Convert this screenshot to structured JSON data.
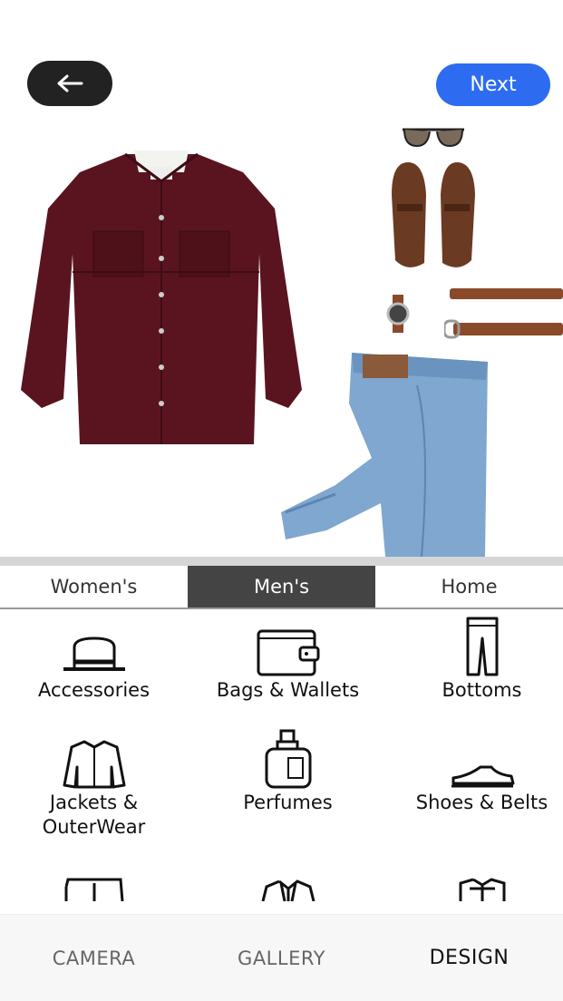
{
  "header": {
    "next_label": "Next"
  },
  "tabs": [
    {
      "label": "Women's",
      "active": false
    },
    {
      "label": "Men's",
      "active": true
    },
    {
      "label": "Home",
      "active": false
    }
  ],
  "categories": [
    {
      "label": "Accessories",
      "icon": "hat-icon"
    },
    {
      "label": "Bags & Wallets",
      "icon": "wallet-icon"
    },
    {
      "label": "Bottoms",
      "icon": "pants-icon"
    },
    {
      "label": "Jackets & OuterWear",
      "icon": "jacket-icon"
    },
    {
      "label": "Perfumes",
      "icon": "perfume-icon"
    },
    {
      "label": "Shoes & Belts",
      "icon": "shoe-icon"
    },
    {
      "label": "",
      "icon": "shorts-icon"
    },
    {
      "label": "",
      "icon": "suit-icon"
    },
    {
      "label": "",
      "icon": "shirt-icon"
    }
  ],
  "bottom_nav": [
    {
      "label": "CAMERA",
      "active": false
    },
    {
      "label": "GALLERY",
      "active": false
    },
    {
      "label": "DESIGN",
      "active": true
    }
  ],
  "colors": {
    "accent": "#2d6cf0",
    "dark": "#222222",
    "active_tab": "#444444"
  }
}
